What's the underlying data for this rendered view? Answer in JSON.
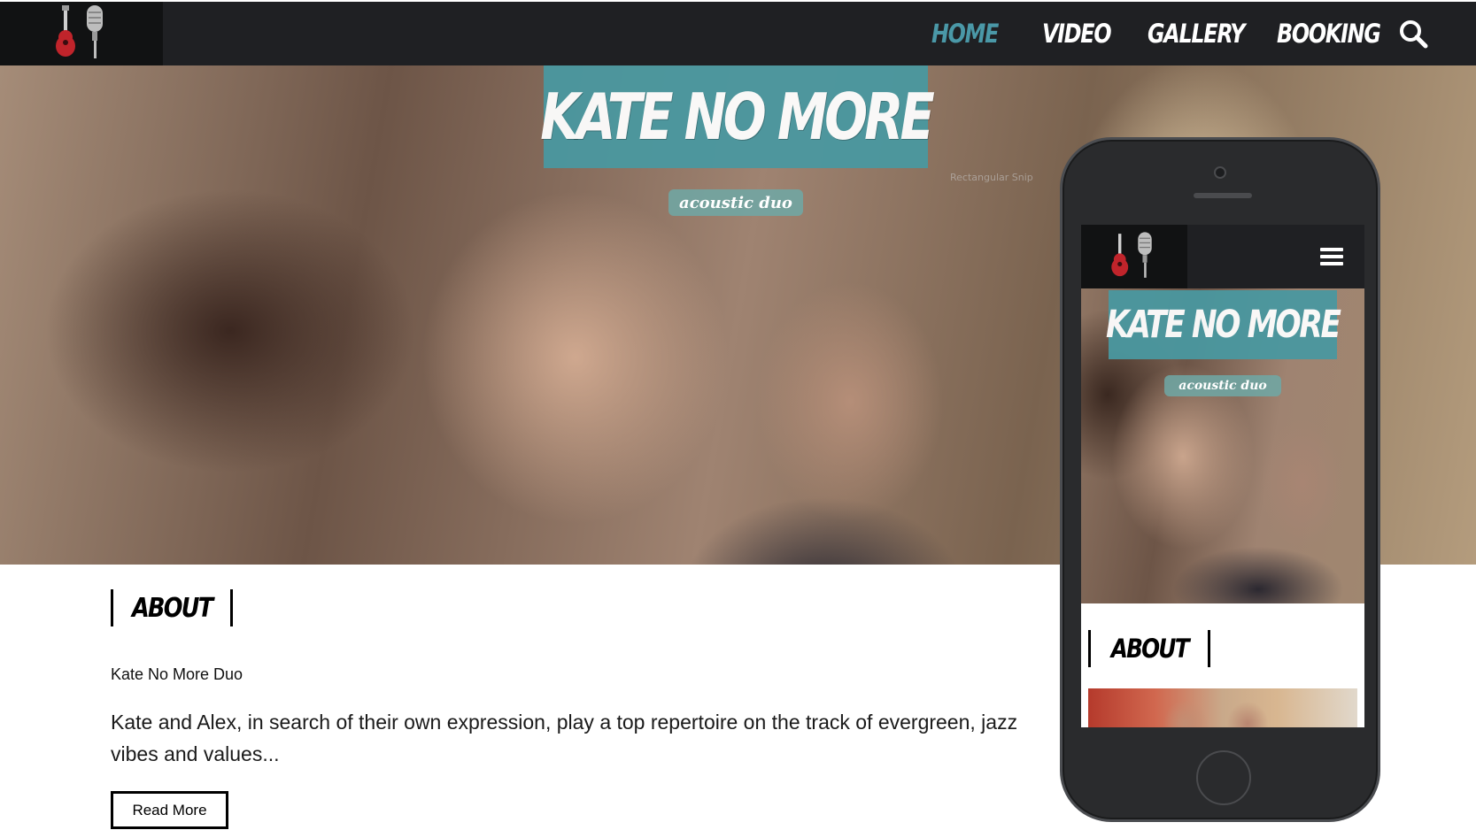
{
  "nav": {
    "items": [
      {
        "label": "HOME",
        "active": true
      },
      {
        "label": "VIDEO",
        "active": false
      },
      {
        "label": "GALLERY",
        "active": false
      },
      {
        "label": "BOOKING",
        "active": false
      }
    ],
    "search_icon": "search-icon",
    "logo_icon": "guitar-microphone-logo"
  },
  "hero": {
    "title": "KATE NO MORE",
    "subtitle": "acoustic duo",
    "snip_tooltip": "Rectangular Snip"
  },
  "about": {
    "heading": "ABOUT",
    "subtitle": "Kate No More Duo",
    "text": "Kate and Alex, in search of their own expression, play a top repertoire on the track of evergreen, jazz vibes and values...",
    "read_more": "Read More"
  },
  "phone": {
    "title": "KATE NO MORE",
    "subtitle": "acoustic duo",
    "about_heading": "ABOUT",
    "menu_icon": "hamburger-menu-icon"
  },
  "colors": {
    "accent": "#4a98a0",
    "nav_active": "#4a98a7",
    "nav_bg": "#1f2023"
  }
}
